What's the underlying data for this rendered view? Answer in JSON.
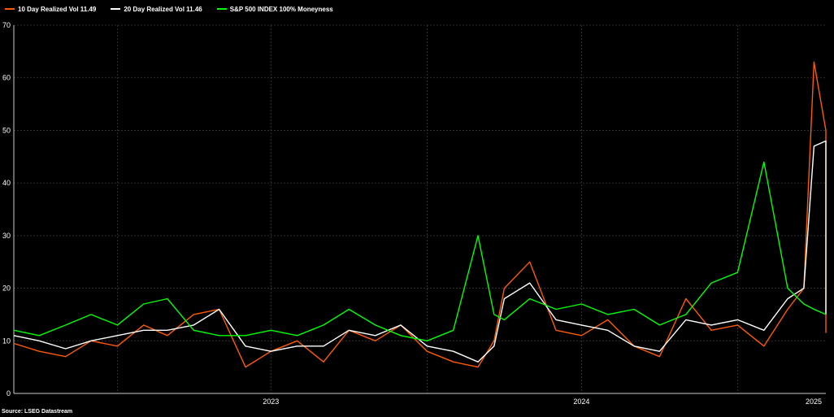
{
  "chart_data": {
    "type": "line",
    "source": "Source: LSEG Datastream",
    "ylim": [
      0,
      70
    ],
    "yticks": [
      0,
      10,
      20,
      30,
      40,
      50,
      60,
      70
    ],
    "xlim": [
      "2022-09-01",
      "2025-04-15"
    ],
    "xtick_labels": [
      {
        "date": "2023-01-01",
        "label": "2023"
      },
      {
        "date": "2024-01-01",
        "label": "2024"
      },
      {
        "date": "2025-01-01",
        "label": "2025"
      }
    ],
    "gridlines": [
      "2023-07-01",
      "2024-07-01"
    ],
    "grid": true,
    "legend_position": "top-left",
    "series": [
      {
        "name": "10 Day Realized Vol 11.49",
        "color": "#ff5a00",
        "dates": [
          "2022-09-01",
          "2022-10-01",
          "2022-11-01",
          "2022-12-01",
          "2023-01-01",
          "2023-02-01",
          "2023-03-01",
          "2023-04-01",
          "2023-05-01",
          "2023-06-01",
          "2023-07-01",
          "2023-08-01",
          "2023-09-01",
          "2023-10-01",
          "2023-11-01",
          "2023-12-01",
          "2024-01-01",
          "2024-02-01",
          "2024-03-01",
          "2024-03-20",
          "2024-04-01",
          "2024-05-01",
          "2024-06-01",
          "2024-07-01",
          "2024-08-01",
          "2024-09-01",
          "2024-10-01",
          "2024-11-01",
          "2024-12-01",
          "2025-01-01",
          "2025-02-01",
          "2025-03-01",
          "2025-03-20",
          "2025-04-01",
          "2025-04-15"
        ],
        "values": [
          9.5,
          8,
          7,
          10,
          9,
          13,
          11,
          15,
          16,
          5,
          8,
          10,
          6,
          12,
          10,
          13,
          8,
          6,
          5,
          10,
          20,
          25,
          12,
          11,
          14,
          9,
          7,
          18,
          12,
          13,
          9,
          16,
          20,
          63,
          50,
          11.5
        ]
      },
      {
        "name": "20 Day Realized Vol 11.46",
        "color": "#ffffff",
        "dates": [
          "2022-09-01",
          "2022-10-01",
          "2022-11-01",
          "2022-12-01",
          "2023-01-01",
          "2023-02-01",
          "2023-03-01",
          "2023-04-01",
          "2023-05-01",
          "2023-06-01",
          "2023-07-01",
          "2023-08-01",
          "2023-09-01",
          "2023-10-01",
          "2023-11-01",
          "2023-12-01",
          "2024-01-01",
          "2024-02-01",
          "2024-03-01",
          "2024-03-20",
          "2024-04-01",
          "2024-05-01",
          "2024-06-01",
          "2024-07-01",
          "2024-08-01",
          "2024-09-01",
          "2024-10-01",
          "2024-11-01",
          "2024-12-01",
          "2025-01-01",
          "2025-02-01",
          "2025-03-01",
          "2025-03-20",
          "2025-04-01",
          "2025-04-15"
        ],
        "values": [
          11,
          10,
          8.5,
          10,
          11,
          12,
          12,
          13,
          16,
          9,
          8,
          9,
          9,
          12,
          11,
          13,
          9,
          8,
          6,
          9,
          18,
          21,
          14,
          13,
          12,
          9,
          8,
          14,
          13,
          14,
          12,
          18,
          20,
          47,
          48,
          15
        ]
      },
      {
        "name": "S&P 500 INDEX 100% Moneyness",
        "color": "#00ff00",
        "dates": [
          "2022-09-01",
          "2022-10-01",
          "2022-11-01",
          "2022-12-01",
          "2023-01-01",
          "2023-02-01",
          "2023-03-01",
          "2023-04-01",
          "2023-05-01",
          "2023-06-01",
          "2023-07-01",
          "2023-08-01",
          "2023-09-01",
          "2023-10-01",
          "2023-11-01",
          "2023-12-01",
          "2024-01-01",
          "2024-02-01",
          "2024-03-01",
          "2024-03-20",
          "2024-04-01",
          "2024-05-01",
          "2024-06-01",
          "2024-07-01",
          "2024-08-01",
          "2024-09-01",
          "2024-10-01",
          "2024-11-01",
          "2024-12-01",
          "2025-01-01",
          "2025-02-01",
          "2025-03-01",
          "2025-03-20",
          "2025-04-01",
          "2025-04-15"
        ],
        "values": [
          12,
          11,
          13,
          15,
          13,
          17,
          18,
          12,
          11,
          11,
          12,
          11,
          13,
          16,
          13,
          11,
          10,
          12,
          30,
          15,
          14,
          18,
          16,
          17,
          15,
          16,
          13,
          15,
          21,
          23,
          44,
          20,
          17,
          16,
          15
        ]
      }
    ]
  }
}
